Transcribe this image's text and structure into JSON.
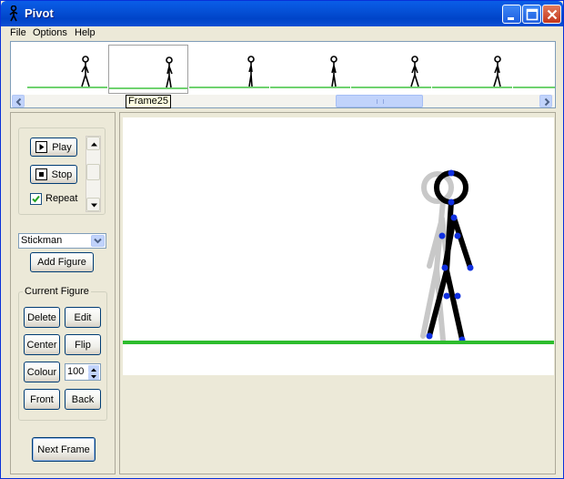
{
  "window": {
    "title": "Pivot"
  },
  "menu": [
    "File",
    "Options",
    "Help"
  ],
  "filmstrip": {
    "tooltip": "Frame25",
    "selected_frame_index": 1,
    "scroll_position": 0.6
  },
  "animation": {
    "play_label": "Play",
    "stop_label": "Stop",
    "repeat_label": "Repeat",
    "repeat_checked": true
  },
  "figure_select": {
    "value": "Stickman"
  },
  "add_figure_label": "Add Figure",
  "current_figure": {
    "legend": "Current Figure",
    "delete_label": "Delete",
    "edit_label": "Edit",
    "center_label": "Center",
    "flip_label": "Flip",
    "colour_label": "Colour",
    "size_value": "100",
    "front_label": "Front",
    "back_label": "Back"
  },
  "next_frame_label": "Next Frame",
  "colors": {
    "ground": "#2dbd2d",
    "joint_handle": "#1030e0",
    "onion_skin": "#c8c8c8",
    "titlebar": "#0550d6"
  },
  "icons": {
    "app": "stickman-icon",
    "minimize": "minimize-icon",
    "maximize": "maximize-icon",
    "close": "close-icon",
    "play": "play-icon",
    "stop": "stop-icon"
  }
}
